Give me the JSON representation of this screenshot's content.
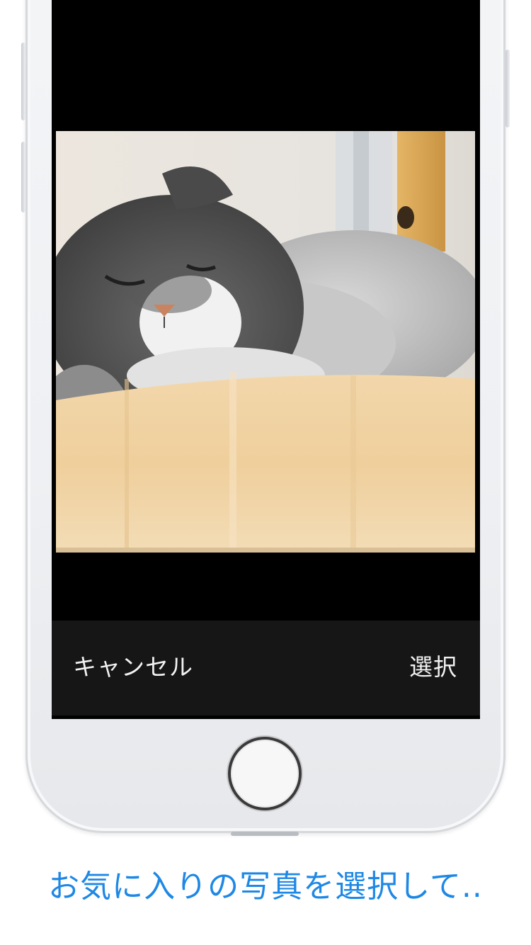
{
  "toolbar": {
    "cancel_label": "キャンセル",
    "select_label": "選択"
  },
  "caption": {
    "text": "お気に入りの写真を選択して.."
  },
  "colors": {
    "caption": "#1e88e5",
    "toolbar_background": "#161616",
    "toolbar_text": "#f2f2f2",
    "screen_background": "#000000"
  },
  "icons": {
    "home_button": "circle-ring-icon"
  }
}
